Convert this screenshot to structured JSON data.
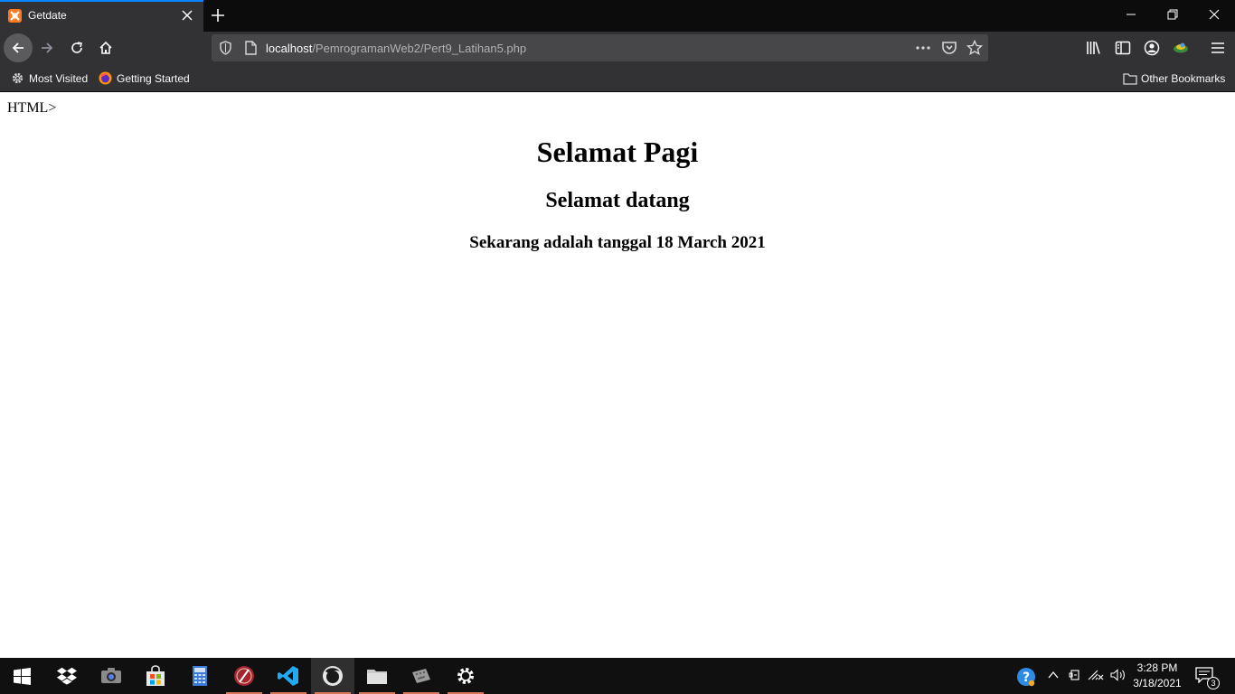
{
  "browser": {
    "tab": {
      "title": "Getdate"
    },
    "url": {
      "host": "localhost",
      "path": "/PemrogramanWeb2/Pert9_Latihan5.php"
    },
    "bookmarks": {
      "most_visited": "Most Visited",
      "getting_started": "Getting Started",
      "other": "Other Bookmarks"
    },
    "accent_color": "#0a84ff"
  },
  "page": {
    "stray_text": "HTML>",
    "heading1": "Selamat Pagi",
    "heading2": "Selamat datang",
    "heading3": "Sekarang adalah tanggal 18 March 2021"
  },
  "taskbar": {
    "apps": [
      "start-icon",
      "dropbox-icon",
      "camera-icon",
      "store-icon",
      "calculator-icon",
      "app-red-icon",
      "vscode-icon",
      "firefox-icon",
      "file-explorer-icon",
      "keyboard-tool-icon",
      "settings-icon"
    ],
    "clock": {
      "time": "3:28 PM",
      "date": "3/18/2021"
    },
    "notification_count": "3"
  }
}
